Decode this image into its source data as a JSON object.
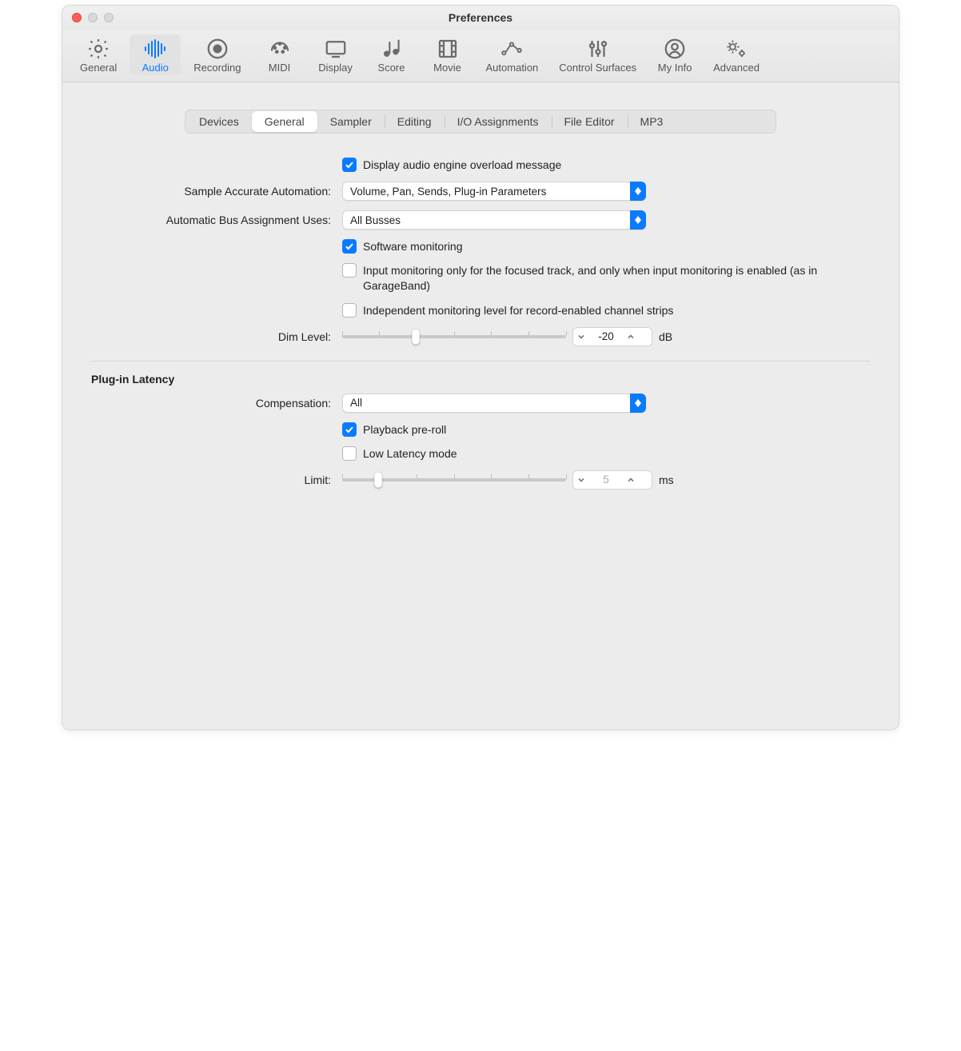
{
  "window": {
    "title": "Preferences"
  },
  "toolbar": {
    "items": [
      {
        "label": "General"
      },
      {
        "label": "Audio"
      },
      {
        "label": "Recording"
      },
      {
        "label": "MIDI"
      },
      {
        "label": "Display"
      },
      {
        "label": "Score"
      },
      {
        "label": "Movie"
      },
      {
        "label": "Automation"
      },
      {
        "label": "Control Surfaces"
      },
      {
        "label": "My Info"
      },
      {
        "label": "Advanced"
      }
    ],
    "selected": "Audio"
  },
  "subtabs": {
    "items": [
      "Devices",
      "General",
      "Sampler",
      "Editing",
      "I/O Assignments",
      "File Editor",
      "MP3"
    ],
    "selected": "General"
  },
  "settings": {
    "overload_label": "Display audio engine overload message",
    "sample_accurate_label": "Sample Accurate Automation:",
    "sample_accurate_value": "Volume, Pan, Sends, Plug-in Parameters",
    "bus_label": "Automatic Bus Assignment Uses:",
    "bus_value": "All Busses",
    "sw_mon_label": "Software monitoring",
    "input_mon_label": "Input monitoring only for the focused track, and only when input monitoring is enabled (as in GarageBand)",
    "indep_mon_label": "Independent monitoring level for record-enabled channel strips",
    "dim_label": "Dim Level:",
    "dim_value": "-20",
    "dim_unit": "dB"
  },
  "latency": {
    "section": "Plug-in Latency",
    "comp_label": "Compensation:",
    "comp_value": "All",
    "preroll_label": "Playback pre-roll",
    "lowlat_label": "Low Latency mode",
    "limit_label": "Limit:",
    "limit_value": "5",
    "limit_unit": "ms"
  }
}
